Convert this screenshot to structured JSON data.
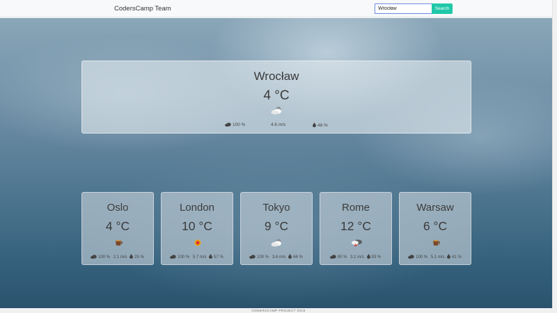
{
  "navbar": {
    "brand": "CodersCamp Team",
    "search": {
      "value": "Wrocław",
      "button_label": "Search"
    }
  },
  "current": {
    "city": "Wrocław",
    "temp": "4 °C",
    "icon": "partly-cloudy-icon",
    "clouds": "100 %",
    "wind": "4.6 m/s",
    "humidity": "48 %"
  },
  "cities": [
    {
      "name": "Oslo",
      "temp": "4 °C",
      "icon": "cup-icon",
      "clouds": "100 %",
      "wind": "2.1 m/s",
      "humidity": "25 %"
    },
    {
      "name": "London",
      "temp": "10 °C",
      "icon": "sun-icon",
      "clouds": "100 %",
      "wind": "5.7 m/s",
      "humidity": "57 %"
    },
    {
      "name": "Tokyo",
      "temp": "9 °C",
      "icon": "partly-cloudy-icon",
      "clouds": "100 %",
      "wind": "3.6 m/s",
      "humidity": "66 %"
    },
    {
      "name": "Rome",
      "temp": "12 °C",
      "icon": "storm-icon",
      "clouds": "90 %",
      "wind": "3.1 m/s",
      "humidity": "93 %"
    },
    {
      "name": "Warsaw",
      "temp": "6 °C",
      "icon": "cup-icon",
      "clouds": "100 %",
      "wind": "5.1 m/s",
      "humidity": "41 %"
    }
  ],
  "footer": {
    "text": "CODERSCAMP PROJECT 2019"
  },
  "colors": {
    "accent": "#1fc8a8",
    "input_border": "#6c8ae4",
    "navbar_bg": "#f8f9fa"
  }
}
